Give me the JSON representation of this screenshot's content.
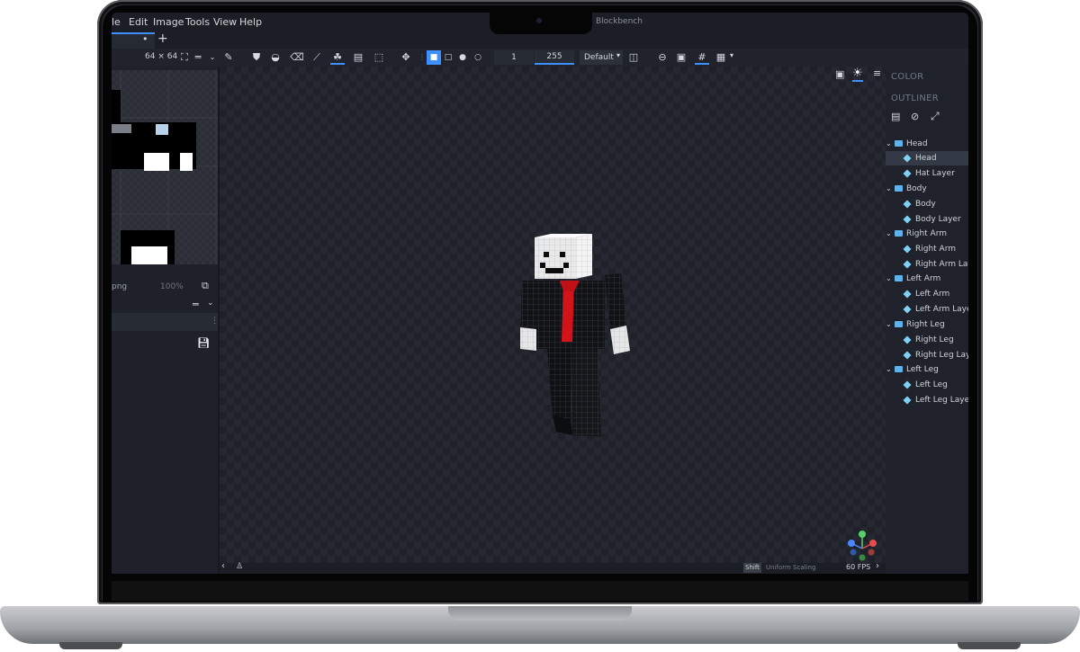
{
  "window": {
    "title": "Blockbench"
  },
  "menu": [
    "le",
    "Edit",
    "Image",
    "Tools",
    "View",
    "Help"
  ],
  "tabs": {
    "dot": "•",
    "add": "+"
  },
  "toolbar": {
    "texture_size": "64 × 64",
    "brush_size": "1",
    "opacity": "255",
    "blend_mode": "Default"
  },
  "left_panel": {
    "filename": "png",
    "zoom": "100%"
  },
  "right_panel": {
    "color_title": "COLOR",
    "outliner_title": "OUTLINER",
    "groups": [
      {
        "name": "Head",
        "children": [
          "Head",
          "Hat Layer"
        ]
      },
      {
        "name": "Body",
        "children": [
          "Body",
          "Body Layer"
        ]
      },
      {
        "name": "Right Arm",
        "children": [
          "Right Arm",
          "Right Arm Layer"
        ]
      },
      {
        "name": "Left Arm",
        "children": [
          "Left Arm",
          "Left Arm Layer"
        ]
      },
      {
        "name": "Right Leg",
        "children": [
          "Right Leg",
          "Right Leg Layer"
        ]
      },
      {
        "name": "Left Leg",
        "children": [
          "Left Leg",
          "Left Leg Layer"
        ]
      }
    ]
  },
  "status": {
    "shift_key": "Shift",
    "hint": "Uniform Scaling",
    "fps": "60 FPS"
  },
  "colors": {
    "accent": "#3e90ff",
    "tie": "#d2141a",
    "suit": "#101114",
    "skin": "#e9e9e9"
  },
  "icons": [
    "brush-icon",
    "fill-icon",
    "eraser-icon",
    "eyedropper-icon",
    "selection-icon",
    "move-icon",
    "square-icon",
    "circle-icon",
    "grid-icon",
    "sun-icon",
    "menu-icon",
    "gizmo-icon"
  ]
}
